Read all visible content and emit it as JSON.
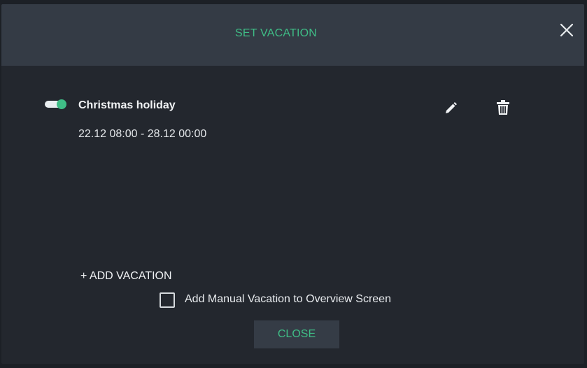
{
  "dialog": {
    "title": "SET VACATION",
    "close_icon": "close-icon"
  },
  "vacations": [
    {
      "enabled": true,
      "name": "Christmas holiday",
      "range": "22.12 08:00 - 28.12 00:00",
      "edit_icon": "pencil-icon",
      "delete_icon": "trash-icon"
    }
  ],
  "actions": {
    "add_vacation_label": "+ ADD VACATION",
    "manual_vacation_label": "Add Manual Vacation to Overview Screen",
    "manual_vacation_checked": false,
    "close_label": "CLOSE"
  },
  "colors": {
    "accent": "#3fbd86",
    "background": "#23272e",
    "header": "#343b45"
  }
}
